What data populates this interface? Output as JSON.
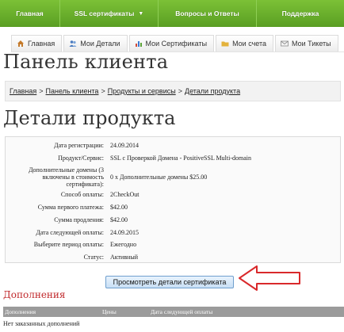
{
  "top_nav": {
    "items": [
      "Главная",
      "SSL сертификаты",
      "Вопросы и Ответы",
      "Поддержка"
    ]
  },
  "sub_nav": {
    "tabs": [
      "Главная",
      "Мои Детали",
      "Мои Сертификаты",
      "Мои счета",
      "Мои Тикеты"
    ]
  },
  "page_title": "Панель клиента",
  "breadcrumb": {
    "items": [
      "Главная",
      "Панель клиента",
      "Продукты и сервисы",
      "Детали продукта"
    ],
    "separator": ">"
  },
  "product_title": "Детали продукта",
  "details": [
    {
      "label": "Дата регистрации:",
      "value": "24.09.2014"
    },
    {
      "label": "Продукт/Сервис:",
      "value": "SSL с Проверкой Домена - PositiveSSL Multi-domain"
    },
    {
      "label": "Дополнительные домены (3 включены в стоимость сертификата):",
      "value": "0 x Дополнительные домены $25.00"
    },
    {
      "label": "Способ оплаты:",
      "value": "2CheckOut"
    },
    {
      "label": "Сумма первого платежа:",
      "value": "$42.00"
    },
    {
      "label": "Сумма продления:",
      "value": "$42.00"
    },
    {
      "label": "Дата следующей оплаты:",
      "value": "24.09.2015"
    },
    {
      "label": "Выберите период оплаты:",
      "value": "Ежегодно"
    },
    {
      "label": "Статус:",
      "value": "Активный"
    }
  ],
  "view_cert_button": "Просмотреть детали сертификата",
  "addons": {
    "title": "Дополнения",
    "columns": [
      "Дополнения",
      "Цены",
      "Дата следующей оплаты"
    ],
    "empty_text": "Нет заказанных дополнений"
  },
  "colors": {
    "nav_green": "#6bb22e",
    "addons_title_red": "#c0282b",
    "arrow_red": "#d9292b"
  }
}
